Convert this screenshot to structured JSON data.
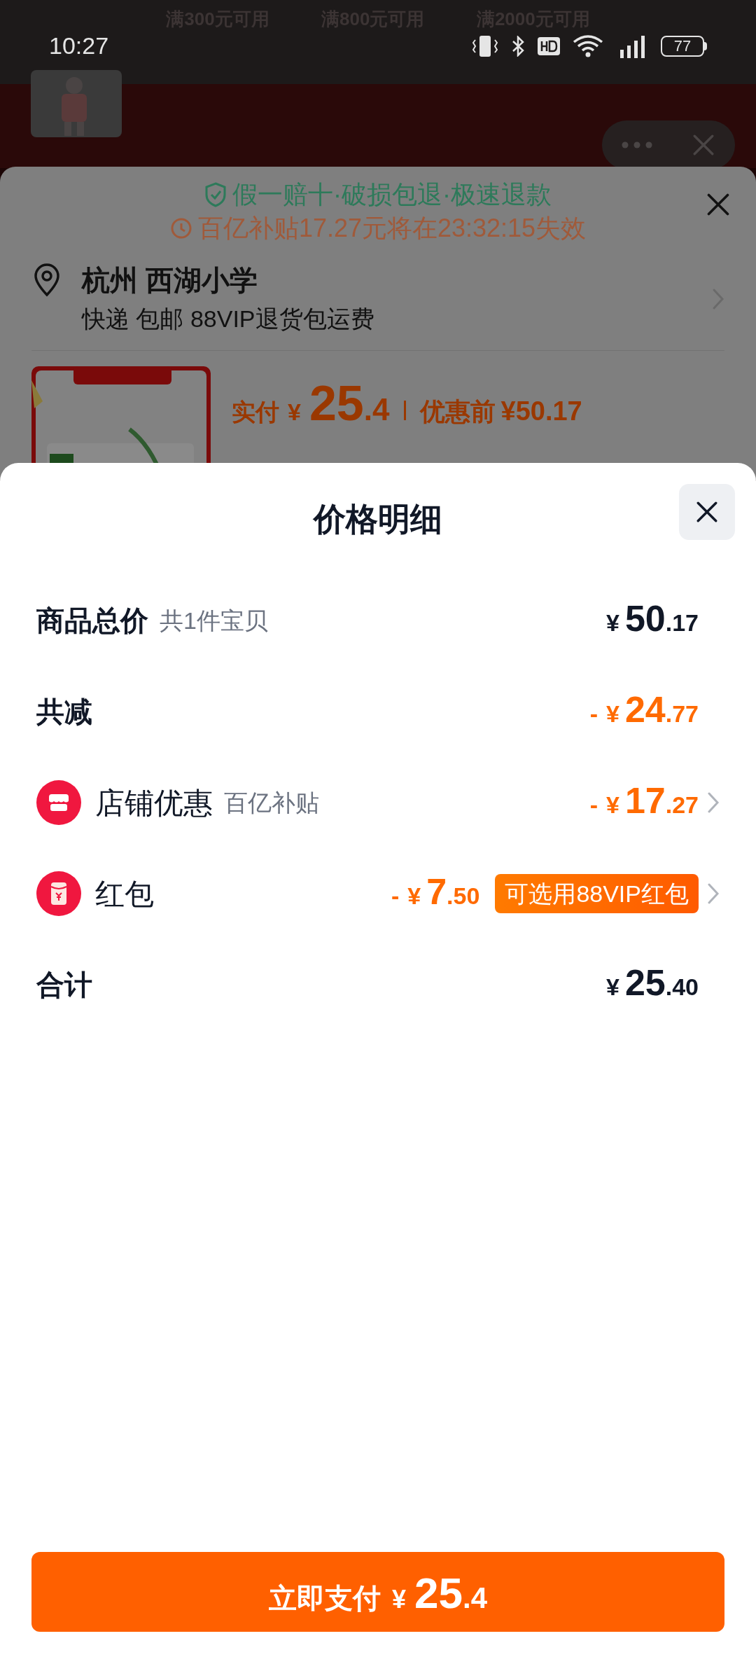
{
  "status_bar": {
    "time": "10:27",
    "battery": "77"
  },
  "background": {
    "coupons": [
      "满300元可用",
      "满800元可用",
      "满2000元可用"
    ]
  },
  "order_sheet": {
    "guarantee": "假一赔十·破损包退·极速退款",
    "subsidy_notice": "百亿补贴17.27元将在23:32:15失效",
    "address": {
      "title": "杭州 西湖小学",
      "delivery": "快递 包邮 88VIP退货包运费"
    },
    "product": {
      "paid_label": "实付",
      "currency": "¥",
      "price_int": "25",
      "price_dec": ".4",
      "before_label": "优惠前",
      "before_price": "¥50.17"
    }
  },
  "price_detail": {
    "title": "价格明细",
    "rows": [
      {
        "kind": "main",
        "label": "商品总价",
        "note": "共1件宝贝",
        "discount": false,
        "sign": "",
        "currency": "¥",
        "int": "50",
        "dec": ".17",
        "chevron": false
      },
      {
        "kind": "main",
        "label": "共减",
        "discount": true,
        "sign": "-",
        "currency": "¥",
        "int": "24",
        "dec": ".77",
        "chevron": false
      },
      {
        "kind": "shop",
        "label": "店铺优惠",
        "note": "百亿补贴",
        "discount": true,
        "sign": "-",
        "currency": "¥",
        "int": "17",
        "dec": ".27",
        "chevron": true
      },
      {
        "kind": "packet",
        "label": "红包",
        "discount": true,
        "sign": "-",
        "currency": "¥",
        "int": "7",
        "dec": ".50",
        "badge": "可选用88VIP红包",
        "chevron": true
      },
      {
        "kind": "main",
        "label": "合计",
        "discount": false,
        "sign": "",
        "currency": "¥",
        "int": "25",
        "dec": ".40",
        "chevron": false
      }
    ]
  },
  "pay_button": {
    "label": "立即支付",
    "currency": "¥",
    "int": "25",
    "dec": ".4"
  }
}
